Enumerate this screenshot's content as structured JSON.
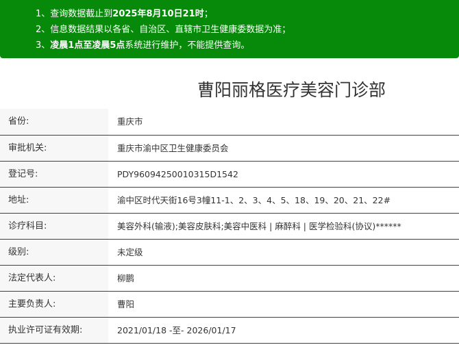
{
  "notice": {
    "line1_prefix": "1、查询数据截止到",
    "line1_bold": "2025年8月10日21时",
    "line1_suffix": "；",
    "line2": "2、信息数据结果以各省、自治区、直辖市卫生健康委数据为准；",
    "line3_prefix": "3、",
    "line3_bold": "凌晨1点至凌晨5点",
    "line3_suffix": "系统进行维护，不能提供查询。"
  },
  "title": "曹阳丽格医疗美容门诊部",
  "rows": [
    {
      "label": "省份:",
      "value": "重庆市"
    },
    {
      "label": "审批机关:",
      "value": "重庆市渝中区卫生健康委员会"
    },
    {
      "label": "登记号:",
      "value": "PDY96094250010315D1542"
    },
    {
      "label": "地址:",
      "value": "渝中区时代天街16号3幢11-1、2、3、4、5、18、19、20、21、22#"
    },
    {
      "label": "诊疗科目:",
      "value": "美容外科(输液);美容皮肤科;美容中医科 | 麻醉科 | 医学检验科(协议)******"
    },
    {
      "label": "级别:",
      "value": "未定级"
    },
    {
      "label": "法定代表人:",
      "value": "柳鹏"
    },
    {
      "label": "主要负责人:",
      "value": "曹阳"
    },
    {
      "label": "执业许可证有效期:",
      "value": "2021/01/18 -至- 2026/01/17"
    }
  ],
  "colors": {
    "notice_bg": "#078a0a",
    "row_border": "#0e5a2e"
  }
}
